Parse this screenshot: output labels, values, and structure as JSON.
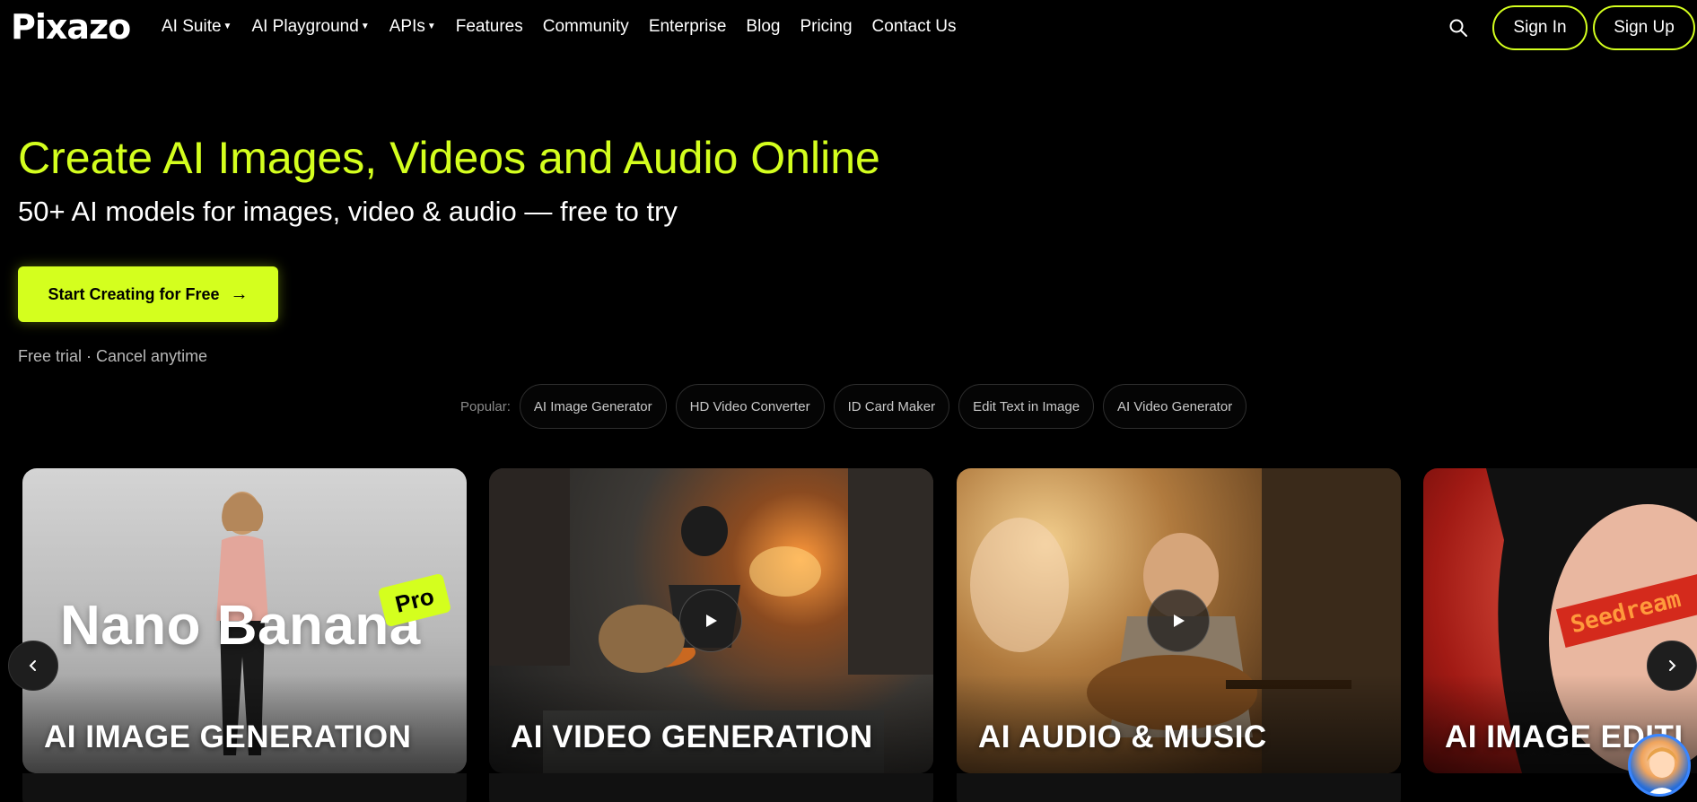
{
  "nav": {
    "logo": "Pixazo",
    "items": [
      {
        "label": "AI Suite",
        "dropdown": true
      },
      {
        "label": "AI Playground",
        "dropdown": true
      },
      {
        "label": "APIs",
        "dropdown": true
      },
      {
        "label": "Features",
        "dropdown": false
      },
      {
        "label": "Community",
        "dropdown": false
      },
      {
        "label": "Enterprise",
        "dropdown": false
      },
      {
        "label": "Blog",
        "dropdown": false
      },
      {
        "label": "Pricing",
        "dropdown": false
      },
      {
        "label": "Contact Us",
        "dropdown": false
      }
    ],
    "signin": "Sign In",
    "signup": "Sign Up"
  },
  "hero": {
    "title": "Create AI Images, Videos and Audio Online",
    "subtitle": "50+ AI models for images, video & audio — free to try",
    "cta": "Start Creating for Free",
    "trial_note": "Free trial · Cancel anytime"
  },
  "popular": {
    "label": "Popular:",
    "chips": [
      "AI Image Generator",
      "HD Video Converter",
      "ID Card Maker",
      "Edit Text in Image",
      "AI Video Generator"
    ]
  },
  "cards": [
    {
      "title": "AI IMAGE GENERATION",
      "overlay_text": "Nano Banana",
      "badge": "Pro"
    },
    {
      "title": "AI VIDEO GENERATION"
    },
    {
      "title": "AI AUDIO & MUSIC"
    },
    {
      "title": "AI IMAGE EDITI",
      "band_text": "Seedream"
    }
  ],
  "colors": {
    "accent": "#d4ff1e",
    "background": "#000000"
  },
  "icons": {
    "search": "search-icon",
    "prev": "chevron-left-icon",
    "next": "chevron-right-icon",
    "play": "play-icon"
  }
}
